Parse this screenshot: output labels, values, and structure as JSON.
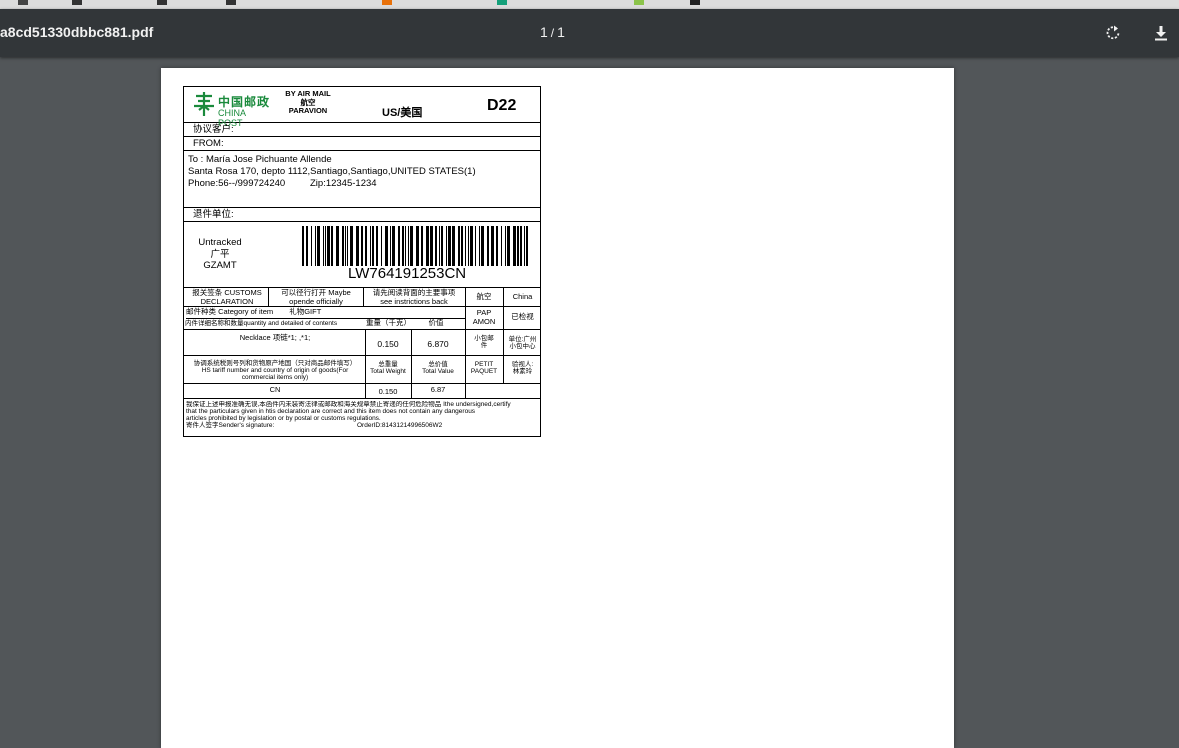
{
  "viewer": {
    "filename": "a8cd51330dbbc881.pdf",
    "current_page": "1",
    "page_separator": "/",
    "total_pages": "1",
    "rotate_icon": "rotate-icon",
    "download_icon": "download-icon"
  },
  "label": {
    "logo_cn": "中国邮政",
    "logo_en": "CHINA POST",
    "brand_color": "#1a8a3c",
    "by_air_mail": "BY AIR MAIL",
    "air_cn": "航空",
    "paravion": "PARAVION",
    "destination": "US/美国",
    "zone": "D22",
    "agreement_customer": "协议客户:",
    "from": "FROM:",
    "to_line1": "To : María Jose Pichuante Allende",
    "to_line2": "Santa Rosa 170, depto 1112,Santiago,Santiago,UNITED STATES(1)",
    "phone": "Phone:56--/999724240",
    "zip": "Zip:12345-1234",
    "return_unit": "退件单位:",
    "service_line1": "Untracked",
    "service_line2": "广平",
    "service_line3": "GZAMT",
    "tracking_number": "LW764191253CN",
    "customs": {
      "decl_cn": "报关签条 CUSTOMS",
      "decl_en": "DECLARATION",
      "maybe_opened_1": "可以径行打开 Maybe",
      "maybe_opened_2": "opende officially",
      "instructions_1": "请先阅读背面的主要事项",
      "instructions_2": "see instrictions back",
      "air": "航空",
      "origin": "China",
      "category": "邮件种类 Category of item",
      "category_value": "礼物GIFT",
      "pap_1": "PAP",
      "pap_2": "AMON",
      "inspected": "已检视",
      "contents_header": "内件详细名称和数量quantity and detailed of contents",
      "weight_header": "重量（千克）",
      "value_header": "价值",
      "item_desc": "Necklace 项链*1; ,*1;",
      "item_weight": "0.150",
      "item_value": "6.870",
      "small_packet_1": "小包邮",
      "small_packet_2": "件",
      "unit_1": "单位:广州",
      "unit_2": "小包中心",
      "hs_1": "协调系统税则号列和货物原产地国（只对商品邮件填写）",
      "hs_2": "HS tariff number and country of origin of goods(For",
      "hs_3": "commercial items only)",
      "total_weight_cn": "总重量",
      "total_weight_en": "Total Weight",
      "total_value_cn": "总价值",
      "total_value_en": "Total Value",
      "petit_1": "PETIT",
      "petit_2": "PAQUET",
      "inspector_1": "验视人:",
      "inspector_2": "林素玲",
      "country": "CN",
      "total_weight": "0.150",
      "total_value": "6.87"
    },
    "certify_1": "我保证上述申报准确无误,本函件内未装寄法律或邮政和海关规章禁止寄递的任何危险物品 Ithe undersigned,certify",
    "certify_2": "that the particulars given in htis declaration are correct and this item does not contain any dangerous",
    "certify_3": "articles prohibited by legislation or by postal or customs regulations.",
    "signature": "寄件人签字Sender's signature:",
    "order_id": "OrderID:81431214996506W2"
  }
}
